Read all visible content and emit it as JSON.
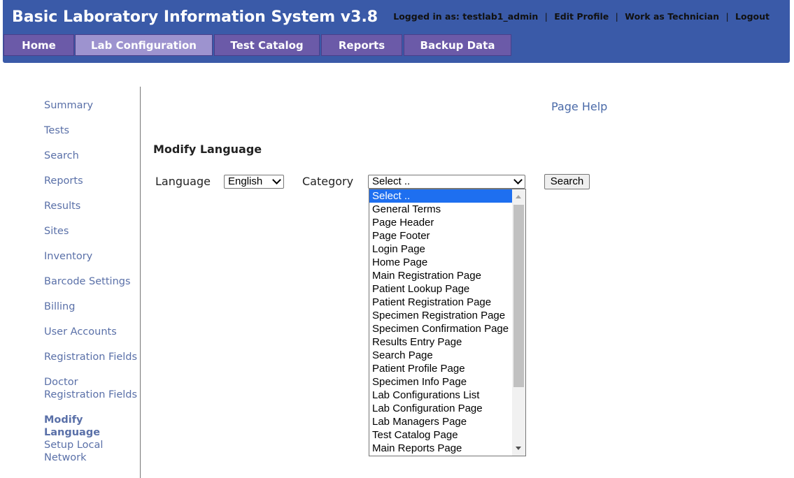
{
  "app": {
    "title": "Basic Laboratory Information System v3.8"
  },
  "user_bar": {
    "logged_in_text": "Logged in as: testlab1_admin",
    "edit_profile": "Edit Profile",
    "work_as_technician": "Work as Technician",
    "logout": "Logout",
    "separator": "|"
  },
  "nav": {
    "tabs": [
      {
        "label": "Home"
      },
      {
        "label": "Lab Configuration",
        "active": true
      },
      {
        "label": "Test Catalog"
      },
      {
        "label": "Reports"
      },
      {
        "label": "Backup Data"
      }
    ]
  },
  "sidebar": {
    "items": [
      {
        "label": "Summary"
      },
      {
        "label": "Tests"
      },
      {
        "label": "Search"
      },
      {
        "label": "Reports"
      },
      {
        "label": "Results"
      },
      {
        "label": "Sites"
      },
      {
        "label": "Inventory"
      },
      {
        "label": "Barcode Settings"
      },
      {
        "label": "Billing"
      },
      {
        "label": "User Accounts"
      },
      {
        "label": "Registration Fields"
      },
      {
        "label": "Doctor Registration Fields"
      },
      {
        "label": "Modify Language",
        "active": true
      },
      {
        "label": "Setup Local Network"
      }
    ]
  },
  "main": {
    "page_help": "Page Help",
    "section_title": "Modify Language",
    "language_label": "Language",
    "language_value": "English",
    "category_label": "Category",
    "category_value": "Select ..",
    "search_button": "Search",
    "category_options": [
      "Select ..",
      "General Terms",
      "Page Header",
      "Page Footer",
      "Login Page",
      "Home Page",
      "Main Registration Page",
      "Patient Lookup Page",
      "Patient Registration Page",
      "Specimen Registration Page",
      "Specimen Confirmation Page",
      "Results Entry Page",
      "Search Page",
      "Patient Profile Page",
      "Specimen Info Page",
      "Lab Configurations List",
      "Lab Configuration Page",
      "Lab Managers Page",
      "Test Catalog Page",
      "Main Reports Page"
    ]
  },
  "colors": {
    "header_bg": "#3a5aa8",
    "tab_bg": "#6b5aa8",
    "tab_active_bg": "#9d93cf",
    "sidebar_link": "#5a70a8",
    "selected_option": "#1e6ff0"
  }
}
